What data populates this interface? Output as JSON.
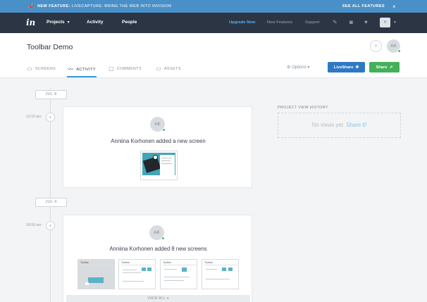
{
  "announcement": {
    "new_feature_label": "New Feature:",
    "text": "LiveCapture: Bring the web into InVision",
    "see_all": "See all features",
    "close": "×"
  },
  "nav": {
    "logo": "in",
    "projects": "Projects",
    "activity": "Activity",
    "people": "People",
    "upgrade": "Upgrade Now",
    "new_features": "New Features",
    "support": "Support",
    "user_initials": "H"
  },
  "project": {
    "title": "Toolbar Demo",
    "owner_initials": "AK",
    "tabs": [
      {
        "label": "SCREENS"
      },
      {
        "label": "ACTIVITY"
      },
      {
        "label": "COMMENTS"
      },
      {
        "label": "ASSETS"
      }
    ],
    "options": "Options",
    "liveshare": "LiveShare",
    "share": "Share"
  },
  "timeline": [
    {
      "date": "JUL 8",
      "time": "10:10 am",
      "initials": "AK",
      "message": "Anniina Korhonen added a new screen"
    },
    {
      "date": "JUL 4",
      "time": "09:50 am",
      "initials": "AK",
      "message": "Anniina Korhonen added 8 new screens",
      "thumb_titles": [
        "Toolbar",
        "Toolbar",
        "Toolbar",
        "Toolbar"
      ],
      "view_all": "VIEW ALL"
    }
  ],
  "history": {
    "label": "PROJECT VIEW HISTORY",
    "empty_text": "No views yet.",
    "share_link": "Share it!"
  },
  "colors": {
    "announcement": "#4a90c8",
    "nav": "#2b3544",
    "accent_blue": "#2e79c5",
    "accent_green": "#45b05a",
    "online": "#4cbb6c"
  }
}
